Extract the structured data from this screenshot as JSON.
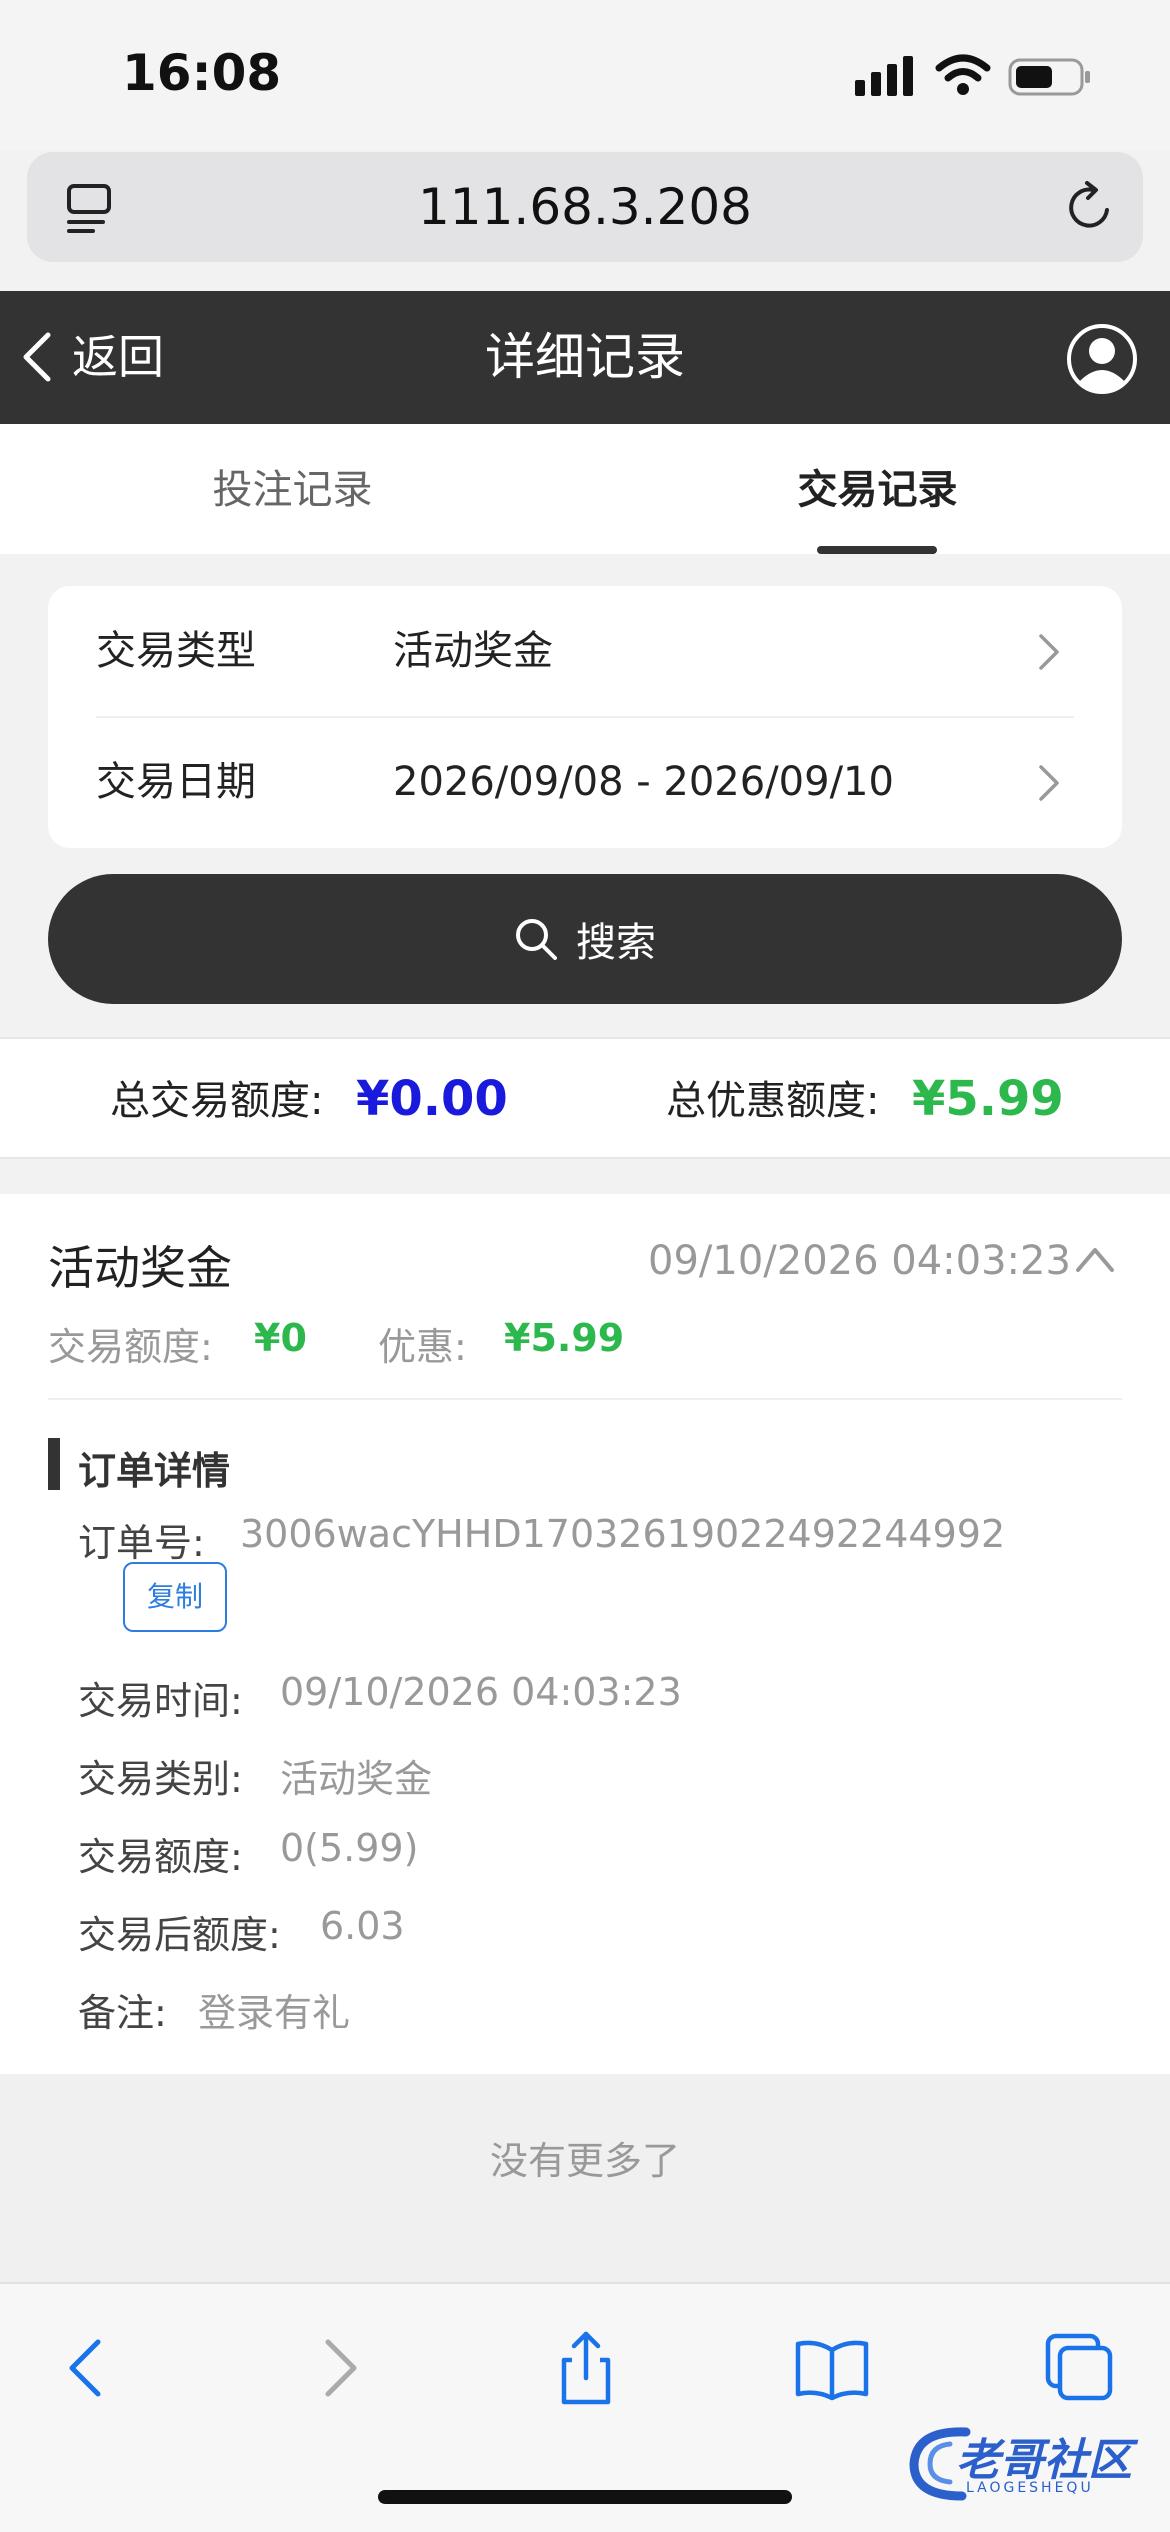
{
  "status_bar": {
    "time": "16:08"
  },
  "browser": {
    "address": "111.68.3.208"
  },
  "header": {
    "back_label": "返回",
    "title": "详细记录"
  },
  "tabs": [
    {
      "label": "投注记录",
      "active": false
    },
    {
      "label": "交易记录",
      "active": true
    }
  ],
  "filters": [
    {
      "label": "交易类型",
      "value": "活动奖金"
    },
    {
      "label": "交易日期",
      "value": "2026/09/08 - 2026/09/10"
    }
  ],
  "search": {
    "label": "搜索"
  },
  "totals": {
    "trade_label": "总交易额度:",
    "trade_value": "¥0.00",
    "discount_label": "总优惠额度:",
    "discount_value": "¥5.99"
  },
  "record": {
    "title": "活动奖金",
    "time": "09/10/2026 04:03:23",
    "amount_label": "交易额度:",
    "amount_value": "¥0",
    "discount_label": "优惠:",
    "discount_value": "¥5.99",
    "detail_title": "订单详情",
    "order_label": "订单号:",
    "order_value": "3006wacYHHD17032619022492244992",
    "copy_label": "复制",
    "details": [
      {
        "label": "交易时间:",
        "value": "09/10/2026 04:03:23"
      },
      {
        "label": "交易类别:",
        "value": "活动奖金"
      },
      {
        "label": "交易额度:",
        "value": "0(5.99)"
      },
      {
        "label": "交易后额度:",
        "value": "6.03"
      },
      {
        "label": "备注:",
        "value": "登录有礼"
      }
    ]
  },
  "footer": {
    "no_more": "没有更多了"
  },
  "watermark": {
    "text": "老哥社区",
    "sub": "LAOGESHEQU"
  },
  "colors": {
    "header_bg": "#333333",
    "blue_total": "#1a1adc",
    "green": "#2db84d",
    "link_blue": "#2d7de0",
    "safari_blue": "#1a73e8"
  }
}
